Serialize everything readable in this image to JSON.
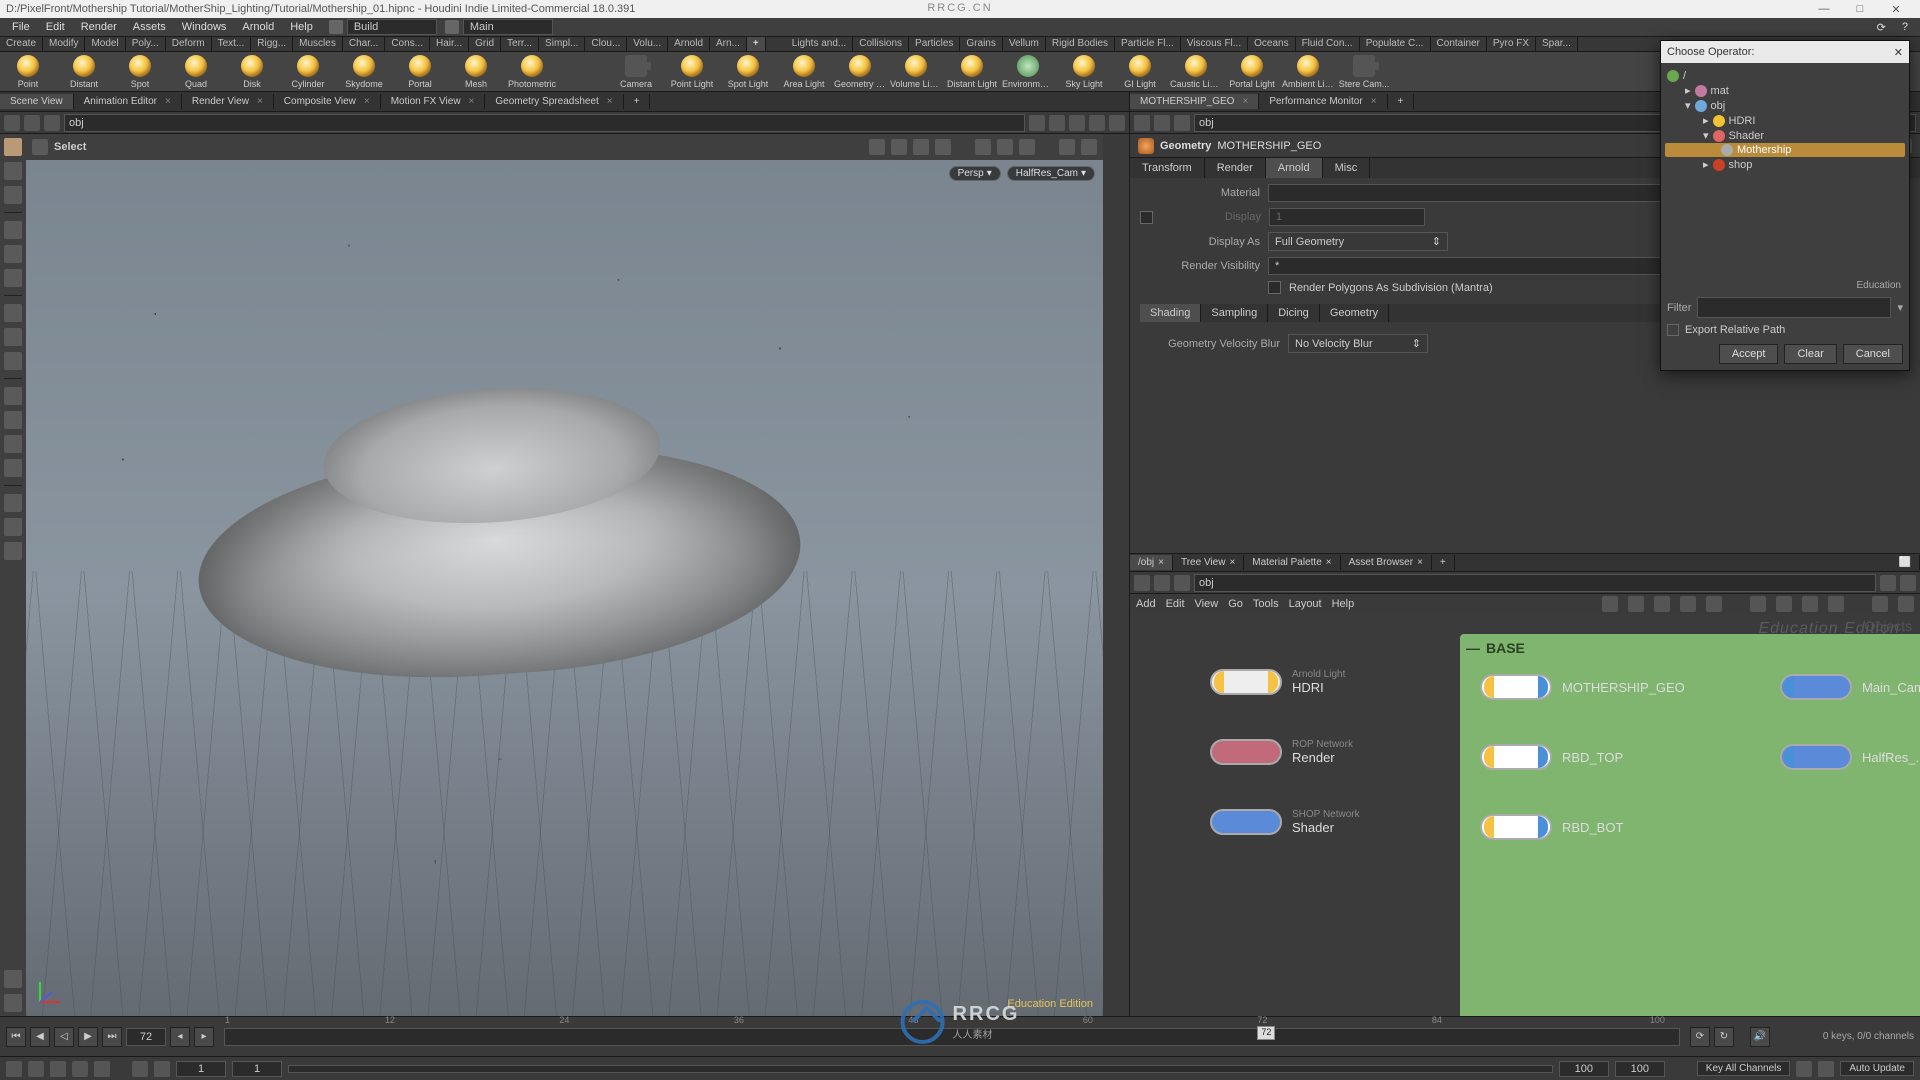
{
  "window": {
    "title": "D:/PixelFront/Mothership Tutorial/MotherShip_Lighting/Tutorial/Mothership_01.hipnc - Houdini Indie Limited-Commercial 18.0.391",
    "top_watermark": "RRCG.CN"
  },
  "menus": [
    "File",
    "Edit",
    "Render",
    "Assets",
    "Windows",
    "Arnold",
    "Help"
  ],
  "desktops": {
    "build": "Build",
    "main": "Main"
  },
  "shelf_tabs_left": [
    "Create",
    "Modify",
    "Model",
    "Poly...",
    "Deform",
    "Text...",
    "Rigg...",
    "Muscles",
    "Char...",
    "Cons...",
    "Hair...",
    "Grid",
    "Terr...",
    "Simpl...",
    "Clou...",
    "Volu...",
    "Arnold",
    "Arn..."
  ],
  "shelf_tabs_right": [
    "Lights and...",
    "Collisions",
    "Particles",
    "Grains",
    "Vellum",
    "Rigid Bodies",
    "Particle Fl...",
    "Viscous Fl...",
    "Oceans",
    "Fluid Con...",
    "Populate C...",
    "Container",
    "Pyro FX",
    "Spar..."
  ],
  "shelf_tools_left": [
    {
      "name": "point",
      "label": "Point"
    },
    {
      "name": "distant",
      "label": "Distant"
    },
    {
      "name": "spot",
      "label": "Spot"
    },
    {
      "name": "quad",
      "label": "Quad"
    },
    {
      "name": "disk",
      "label": "Disk"
    },
    {
      "name": "cylinder",
      "label": "Cylinder"
    },
    {
      "name": "skydome",
      "label": "Skydome"
    },
    {
      "name": "portal",
      "label": "Portal"
    },
    {
      "name": "mesh",
      "label": "Mesh"
    },
    {
      "name": "photometric",
      "label": "Photometric"
    }
  ],
  "shelf_tools_right": [
    {
      "name": "camera",
      "label": "Camera",
      "icon": "cam"
    },
    {
      "name": "pointlight",
      "label": "Point Light"
    },
    {
      "name": "spotlight",
      "label": "Spot Light"
    },
    {
      "name": "arealight",
      "label": "Area Light"
    },
    {
      "name": "geolight",
      "label": "Geometry Light"
    },
    {
      "name": "volumelight",
      "label": "Volume Light"
    },
    {
      "name": "distantlight",
      "label": "Distant Light"
    },
    {
      "name": "envlight",
      "label": "Environment Light",
      "icon": "env"
    },
    {
      "name": "skylight",
      "label": "Sky Light"
    },
    {
      "name": "gilight",
      "label": "GI Light"
    },
    {
      "name": "causticlight",
      "label": "Caustic Light"
    },
    {
      "name": "portallight",
      "label": "Portal Light"
    },
    {
      "name": "ambientlight",
      "label": "Ambient Light"
    },
    {
      "name": "stereocam",
      "label": "Stere Cam...",
      "icon": "cam"
    }
  ],
  "pane_tabs_left": [
    "Scene View",
    "Animation Editor",
    "Render View",
    "Composite View",
    "Motion FX View",
    "Geometry Spreadsheet"
  ],
  "pane_tabs_right_top": [
    "MOTHERSHIP_GEO",
    "Performance Monitor"
  ],
  "path_left": "obj",
  "path_right": "obj",
  "viewport": {
    "tool": "Select",
    "persp": "Persp",
    "camera": "HalfRes_Cam",
    "edu": "Education Edition"
  },
  "parm": {
    "type": "Geometry",
    "name": "MOTHERSHIP_GEO",
    "tabs": [
      "Transform",
      "Render",
      "Arnold",
      "Misc"
    ],
    "active_tab": "Arnold",
    "rows": {
      "material_label": "Material",
      "material_value": "",
      "display_label": "Display",
      "display_value": "1",
      "display_as_label": "Display As",
      "display_as_value": "Full Geometry",
      "render_vis_label": "Render Visibility",
      "render_vis_value": "*",
      "subd_label": "Render Polygons As Subdivision (Mantra)"
    },
    "subtabs": [
      "Shading",
      "Sampling",
      "Dicing",
      "Geometry"
    ],
    "velocity_label": "Geometry Velocity Blur",
    "velocity_value": "No Velocity Blur"
  },
  "net_tabs": [
    "/obj",
    "Tree View",
    "Material Palette",
    "Asset Browser"
  ],
  "net_path": "obj",
  "net_menus": [
    "Add",
    "Edit",
    "View",
    "Go",
    "Tools",
    "Layout",
    "Help"
  ],
  "net": {
    "watermark": "Education Edition",
    "objects_label": "Objects",
    "base_label": "BASE",
    "nodes": {
      "hdri_type": "Arnold Light",
      "hdri": "HDRI",
      "render_type": "ROP Network",
      "render": "Render",
      "shader_type": "SHOP Network",
      "shader": "Shader",
      "mgeo": "MOTHERSHIP_GEO",
      "rbd_top": "RBD_TOP",
      "rbd_bot": "RBD_BOT",
      "main_cam": "Main_Cam",
      "halfres": "HalfRes_..."
    }
  },
  "popup": {
    "title": "Choose Operator:",
    "tree": {
      "root": "/",
      "mat": "mat",
      "obj": "obj",
      "hdri": "HDRI",
      "shader": "Shader",
      "mothership": "Mothership",
      "shop": "shop"
    },
    "education": "Education",
    "filter_label": "Filter",
    "export_label": "Export Relative Path",
    "accept": "Accept",
    "clear": "Clear",
    "cancel": "Cancel"
  },
  "timeline": {
    "frame": "72",
    "ticks": [
      "1",
      "12",
      "24",
      "36",
      "48",
      "60",
      "72",
      "84",
      "100"
    ],
    "cursor": "72",
    "range_start": "1",
    "range_first": "1",
    "range_last": "100",
    "range_end": "100",
    "keys": "0 keys, 0/0 channels",
    "keyall": "Key All Channels",
    "autoupdate": "Auto Update"
  },
  "logo": {
    "text": "RRCG",
    "sub": "人人素材"
  }
}
